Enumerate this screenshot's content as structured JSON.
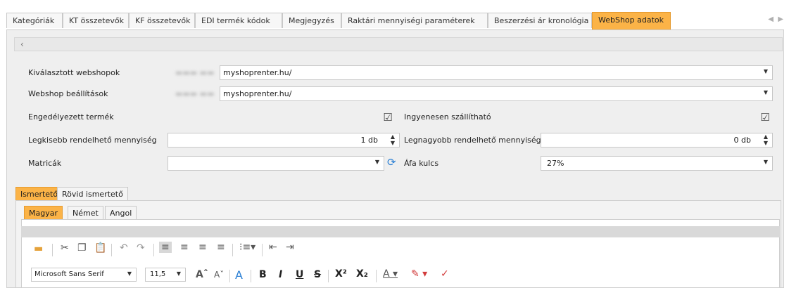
{
  "tabs": [
    "Kategóriák",
    "KT összetevők",
    "KF összetevők",
    "EDI termék kódok",
    "Megjegyzés",
    "Raktári mennyiségi paraméterek",
    "Beszerzési ár kronológia",
    "WebShop adatok"
  ],
  "active_tab": "WebShop adatok",
  "form": {
    "selected_webshops_label": "Kiválasztott webshopok",
    "selected_webshops_value": "myshoprenter.hu/",
    "webshop_settings_label": "Webshop beállítások",
    "webshop_settings_value": "myshoprenter.hu/",
    "enabled_product_label": "Engedélyezett termék",
    "free_shipping_label": "Ingyenesen szállítható",
    "min_qty_label": "Legkisebb rendelhető mennyiség",
    "min_qty_value": "1 db",
    "max_qty_label": "Legnagyobb rendelhető mennyiség",
    "max_qty_value": "0 db",
    "stickers_label": "Matricák",
    "vat_label": "Áfa kulcs",
    "vat_value": "27%"
  },
  "desc_tabs": [
    "Ismertető",
    "Rövid ismertető"
  ],
  "lang_tabs": [
    "Magyar",
    "Német",
    "Angol"
  ],
  "editor": {
    "font_name": "Microsoft Sans Serif",
    "font_size": "11,5"
  },
  "colors": {
    "accent": "#fbb347",
    "panel": "#efefef"
  }
}
